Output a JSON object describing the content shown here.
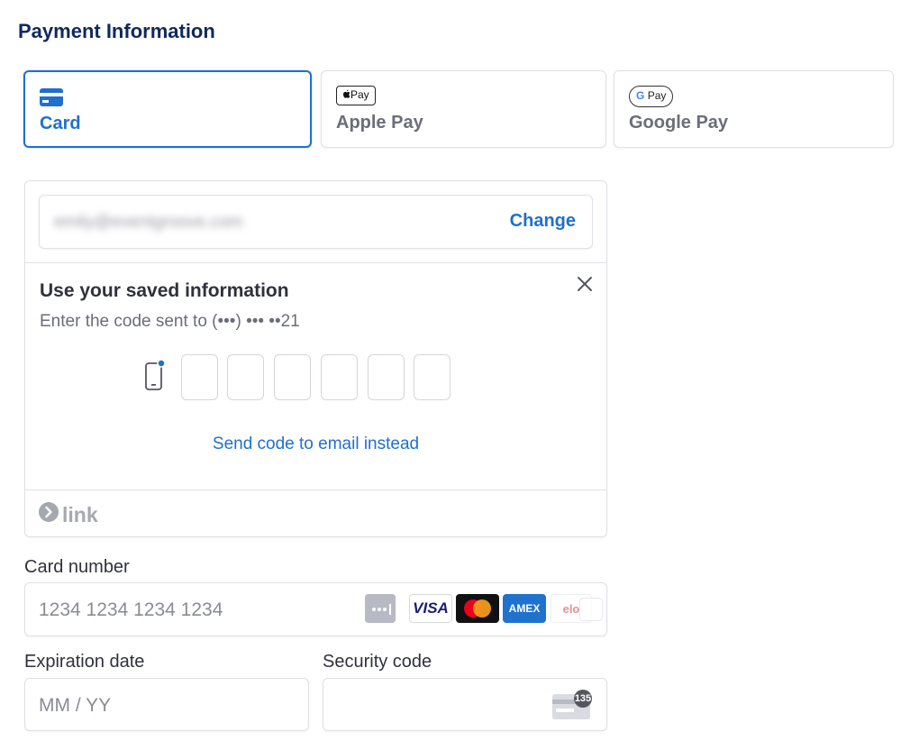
{
  "page": {
    "title": "Payment Information"
  },
  "tabs": [
    {
      "label": "Card",
      "selected": true,
      "icon": "credit-card-icon"
    },
    {
      "label": "Apple Pay",
      "selected": false,
      "icon": "apple-pay-icon",
      "badge": "Pay"
    },
    {
      "label": "Google Pay",
      "selected": false,
      "icon": "google-pay-icon",
      "badge_g": "G",
      "badge": "Pay"
    }
  ],
  "link": {
    "email": "emily@eventgroove.com",
    "change_label": "Change",
    "saved_title": "Use your saved information",
    "saved_subtitle": "Enter the code sent to (•••) ••• ••21",
    "code_digits": [
      "",
      "",
      "",
      "",
      "",
      ""
    ],
    "send_email_label": "Send code to email instead",
    "brand": "link",
    "close_icon": "close-icon"
  },
  "card_number": {
    "label": "Card number",
    "placeholder": "1234 1234 1234 1234",
    "brands": [
      "VISA",
      "AMEX",
      "elo"
    ]
  },
  "expiry": {
    "label": "Expiration date",
    "placeholder": "MM / YY"
  },
  "security": {
    "label": "Security code",
    "placeholder": "",
    "cvc_hint": "135"
  },
  "colors": {
    "accent": "#1f6fd0",
    "title": "#0e2a5c",
    "visa": "#1a1f71",
    "amex": "#1f72cd",
    "mastercard_red": "#eb001b",
    "mastercard_yellow": "#f79e1b"
  }
}
